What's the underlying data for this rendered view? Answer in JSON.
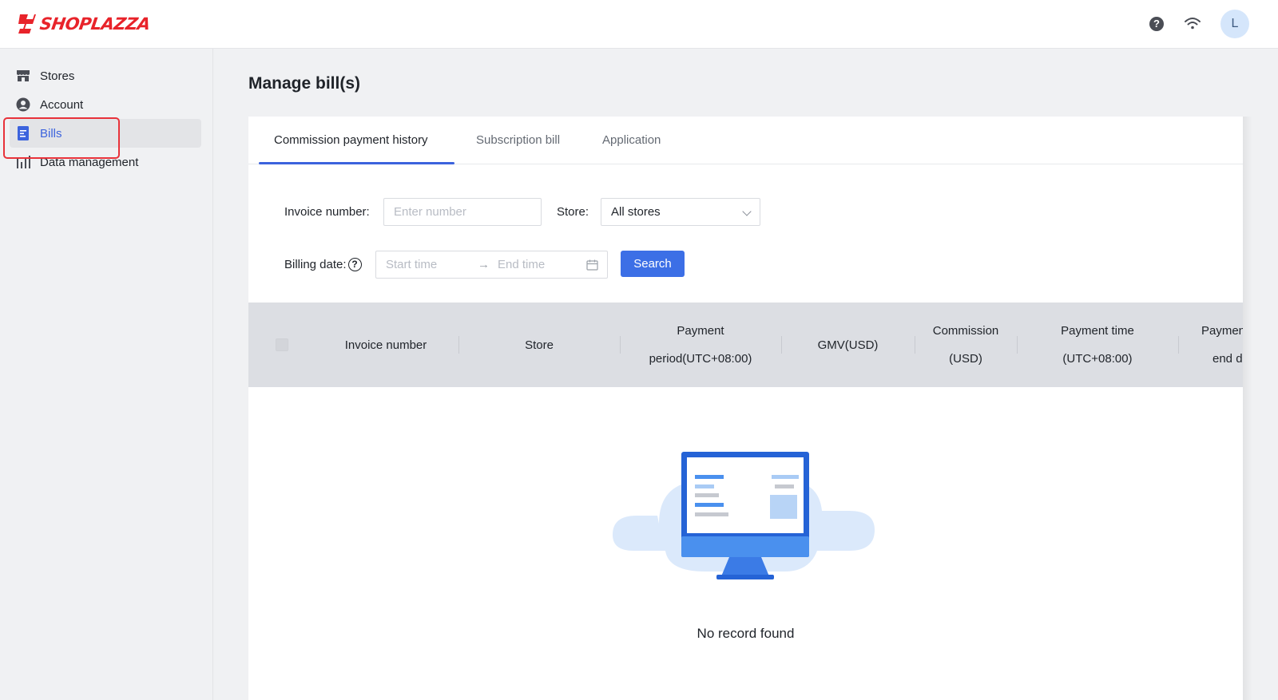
{
  "brand": {
    "logo_text": "SHOPLAZZA",
    "color": "#e8232a"
  },
  "topbar": {
    "avatar_initial": "L",
    "icons": [
      "help-icon",
      "wifi-icon"
    ]
  },
  "sidebar": {
    "items": [
      {
        "label": "Stores",
        "icon": "store-icon"
      },
      {
        "label": "Account",
        "icon": "user-icon"
      },
      {
        "label": "Bills",
        "icon": "bill-icon",
        "active": true
      },
      {
        "label": "Data management",
        "icon": "bar-chart-icon"
      }
    ]
  },
  "main": {
    "title": "Manage bill(s)",
    "tabs": [
      {
        "label": "Commission payment history",
        "active": true
      },
      {
        "label": "Subscription bill"
      },
      {
        "label": "Application"
      }
    ],
    "filters": {
      "invoice_label": "Invoice number:",
      "invoice_placeholder": "Enter number",
      "store_label": "Store:",
      "store_value": "All stores",
      "billing_label": "Billing date:",
      "start_placeholder": "Start time",
      "end_placeholder": "End time",
      "search_label": "Search"
    },
    "table": {
      "columns": [
        {
          "line1": "Invoice number",
          "line2": ""
        },
        {
          "line1": "Store",
          "line2": ""
        },
        {
          "line1": "Payment",
          "line2": "period(UTC+08:00)"
        },
        {
          "line1": "GMV(USD)",
          "line2": ""
        },
        {
          "line1": "Commission",
          "line2": "(USD)"
        },
        {
          "line1": "Payment time",
          "line2": "(UTC+08:00)"
        },
        {
          "line1": "Paymen",
          "line2": "end d"
        }
      ],
      "empty_text": "No record found"
    }
  },
  "colors": {
    "accent": "#3c63dd",
    "button": "#3c6fe6",
    "highlight": "#e8323a"
  }
}
